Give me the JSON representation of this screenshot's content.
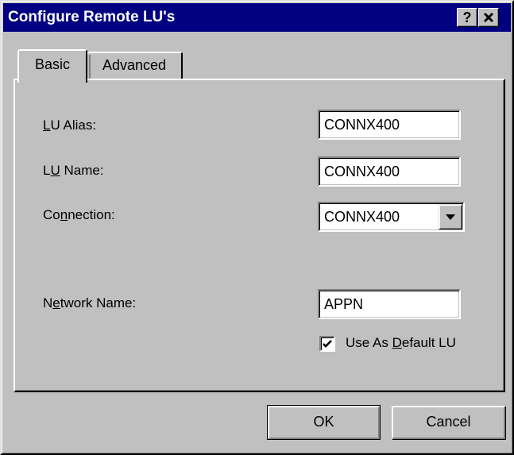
{
  "window": {
    "title": "Configure Remote LU's",
    "help_glyph": "?",
    "colors": {
      "titlebar": "#000080",
      "face": "#c0c0c0"
    }
  },
  "tabs": [
    {
      "label": "Basic",
      "selected": true
    },
    {
      "label": "Advanced",
      "selected": false
    }
  ],
  "form": {
    "lu_alias": {
      "label_pre": "",
      "label_ul": "L",
      "label_post": "U Alias:",
      "value": "CONNX400"
    },
    "lu_name": {
      "label_pre": "L",
      "label_ul": "U",
      "label_post": " Name:",
      "value": "CONNX400"
    },
    "connection": {
      "label_pre": "Co",
      "label_ul": "n",
      "label_post": "nection:",
      "value": "CONNX400"
    },
    "network_name": {
      "label_pre": "N",
      "label_ul": "e",
      "label_post": "twork Name:",
      "value": "APPN"
    },
    "default_lu": {
      "label_pre": "Use As ",
      "label_ul": "D",
      "label_post": "efault LU",
      "checked": true
    }
  },
  "buttons": {
    "ok": "OK",
    "cancel": "Cancel"
  },
  "icons": {
    "help": "help-icon",
    "close": "close-icon",
    "dropdown": "chevron-down-icon",
    "check": "check-icon"
  }
}
